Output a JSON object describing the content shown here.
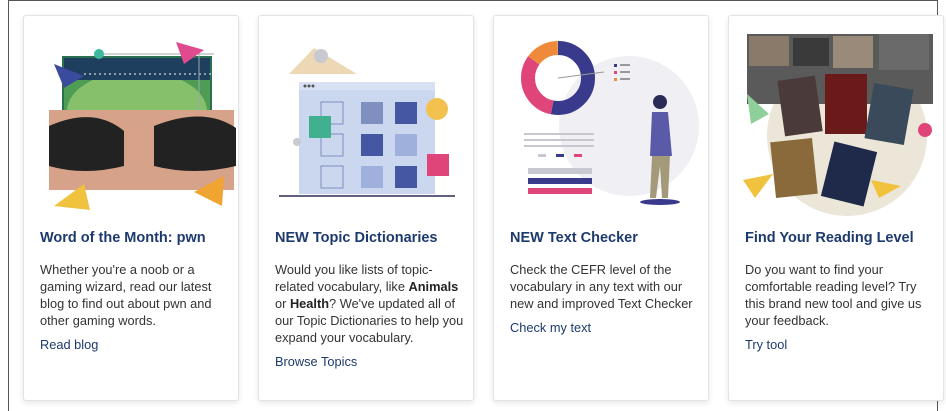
{
  "cards": [
    {
      "title": "Word of the Month: pwn",
      "description": "Whether you're a noob or a gaming wizard, read our latest blog to find out about pwn and other gaming words.",
      "link": "Read blog"
    },
    {
      "title": "NEW Topic Dictionaries",
      "description_parts": {
        "p1": "Would you like lists of topic-related vocabulary, like ",
        "b1": "Animals",
        "p2": " or ",
        "b2": "Health",
        "p3": "? We've updated all of our Topic Dictionaries to help you expand your vocabulary."
      },
      "link": "Browse Topics"
    },
    {
      "title": "NEW Text Checker",
      "description": "Check the CEFR level of the vocabulary in any text with our new and improved Text Checker",
      "link": "Check my text"
    },
    {
      "title": "Find Your Reading Level",
      "description": "Do you want to find your comfortable reading level? Try this brand new tool and give us your feedback.",
      "link": "Try tool"
    }
  ],
  "icons": [
    "gaming-illustration",
    "dictionary-illustration",
    "text-checker-illustration",
    "book-covers-illustration"
  ]
}
